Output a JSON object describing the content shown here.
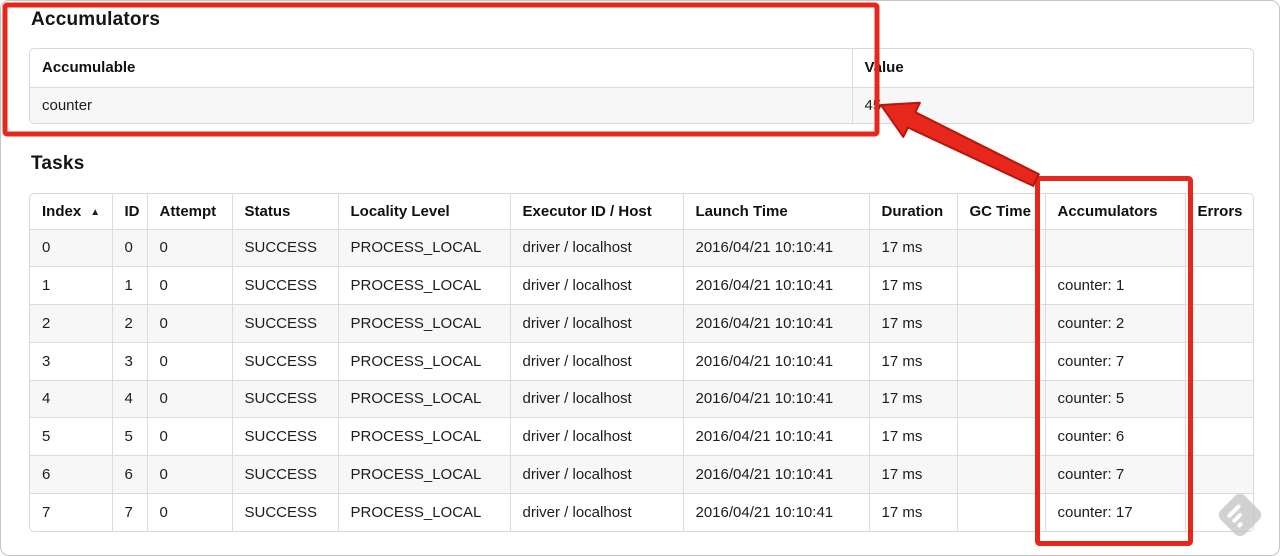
{
  "accumulators_section": {
    "title": "Accumulators",
    "table": {
      "headers": [
        "Accumulable",
        "Value"
      ],
      "rows": [
        [
          "counter",
          "45"
        ]
      ]
    }
  },
  "tasks_section": {
    "title": "Tasks",
    "table": {
      "headers": [
        "Index",
        "ID",
        "Attempt",
        "Status",
        "Locality Level",
        "Executor ID / Host",
        "Launch Time",
        "Duration",
        "GC Time",
        "Accumulators",
        "Errors"
      ],
      "sort_indicator": "▲",
      "sorted_column": "Index",
      "rows": [
        [
          "0",
          "0",
          "0",
          "SUCCESS",
          "PROCESS_LOCAL",
          "driver / localhost",
          "2016/04/21 10:10:41",
          "17 ms",
          "",
          "",
          ""
        ],
        [
          "1",
          "1",
          "0",
          "SUCCESS",
          "PROCESS_LOCAL",
          "driver / localhost",
          "2016/04/21 10:10:41",
          "17 ms",
          "",
          "counter: 1",
          ""
        ],
        [
          "2",
          "2",
          "0",
          "SUCCESS",
          "PROCESS_LOCAL",
          "driver / localhost",
          "2016/04/21 10:10:41",
          "17 ms",
          "",
          "counter: 2",
          ""
        ],
        [
          "3",
          "3",
          "0",
          "SUCCESS",
          "PROCESS_LOCAL",
          "driver / localhost",
          "2016/04/21 10:10:41",
          "17 ms",
          "",
          "counter: 7",
          ""
        ],
        [
          "4",
          "4",
          "0",
          "SUCCESS",
          "PROCESS_LOCAL",
          "driver / localhost",
          "2016/04/21 10:10:41",
          "17 ms",
          "",
          "counter: 5",
          ""
        ],
        [
          "5",
          "5",
          "0",
          "SUCCESS",
          "PROCESS_LOCAL",
          "driver / localhost",
          "2016/04/21 10:10:41",
          "17 ms",
          "",
          "counter: 6",
          ""
        ],
        [
          "6",
          "6",
          "0",
          "SUCCESS",
          "PROCESS_LOCAL",
          "driver / localhost",
          "2016/04/21 10:10:41",
          "17 ms",
          "",
          "counter: 7",
          ""
        ],
        [
          "7",
          "7",
          "0",
          "SUCCESS",
          "PROCESS_LOCAL",
          "driver / localhost",
          "2016/04/21 10:10:41",
          "17 ms",
          "",
          "counter: 17",
          ""
        ]
      ]
    }
  },
  "annotations": {
    "highlight_color": "#e8271c",
    "highlight_outline": "#b5170b",
    "box1_target": "accumulators-summary",
    "box2_target": "accumulators-column",
    "arrow_target": "accumulator-value-45"
  }
}
